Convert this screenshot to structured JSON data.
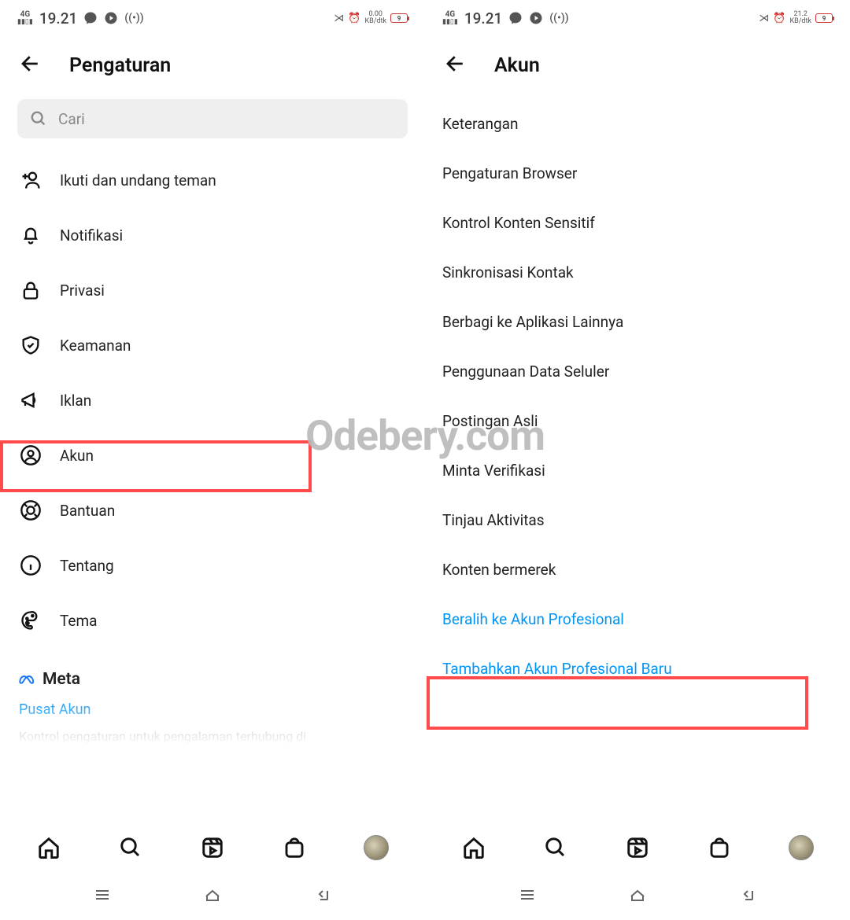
{
  "watermark": "Odebery.com",
  "left": {
    "status": {
      "network": "4G",
      "time": "19.21",
      "data_rate": "0.00",
      "data_unit": "KB/dtk",
      "battery": "9"
    },
    "header_title": "Pengaturan",
    "search_placeholder": "Cari",
    "menu": [
      {
        "label": "Ikuti dan undang teman",
        "icon": "add-user-icon"
      },
      {
        "label": "Notifikasi",
        "icon": "bell-icon"
      },
      {
        "label": "Privasi",
        "icon": "lock-icon"
      },
      {
        "label": "Keamanan",
        "icon": "shield-icon"
      },
      {
        "label": "Iklan",
        "icon": "megaphone-icon"
      },
      {
        "label": "Akun",
        "icon": "user-circle-icon"
      },
      {
        "label": "Bantuan",
        "icon": "lifebuoy-icon"
      },
      {
        "label": "Tentang",
        "icon": "info-icon"
      },
      {
        "label": "Tema",
        "icon": "palette-icon"
      }
    ],
    "meta_label": "Meta",
    "pusat_akun": "Pusat Akun",
    "kontrol_text": "Kontrol pengaturan untuk pengalaman terhubung di"
  },
  "right": {
    "status": {
      "network": "4G",
      "time": "19.21",
      "data_rate": "21.2",
      "data_unit": "KB/dtk",
      "battery": "9"
    },
    "header_title": "Akun",
    "items": [
      {
        "label": "Keterangan",
        "link": false
      },
      {
        "label": "Pengaturan Browser",
        "link": false
      },
      {
        "label": "Kontrol Konten Sensitif",
        "link": false
      },
      {
        "label": "Sinkronisasi Kontak",
        "link": false
      },
      {
        "label": "Berbagi ke Aplikasi Lainnya",
        "link": false
      },
      {
        "label": "Penggunaan Data Seluler",
        "link": false
      },
      {
        "label": "Postingan Asli",
        "link": false
      },
      {
        "label": "Minta Verifikasi",
        "link": false
      },
      {
        "label": "Tinjau Aktivitas",
        "link": false
      },
      {
        "label": "Konten bermerek",
        "link": false
      },
      {
        "label": "Beralih ke Akun Profesional",
        "link": true
      },
      {
        "label": "Tambahkan Akun Profesional Baru",
        "link": true
      }
    ]
  }
}
